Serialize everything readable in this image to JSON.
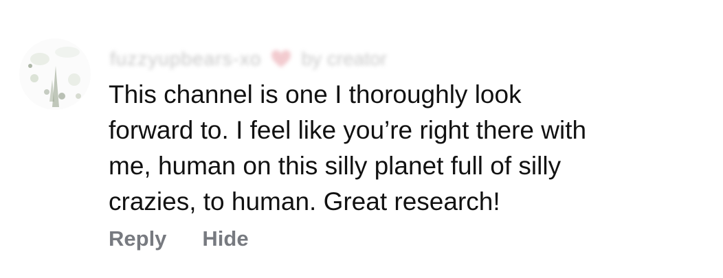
{
  "comment": {
    "avatar_icon": "user-avatar-photo",
    "body_lines": [
      "This channel is one I thoroughly look",
      "forward to. I feel like you’re right there with",
      "me, human on this silly planet full of silly",
      "crazies, to human. Great research!"
    ],
    "heart_icon": "heart-icon",
    "heart_color": "#e8a0a8",
    "actions": {
      "reply_label": "Reply",
      "hide_label": "Hide"
    }
  }
}
